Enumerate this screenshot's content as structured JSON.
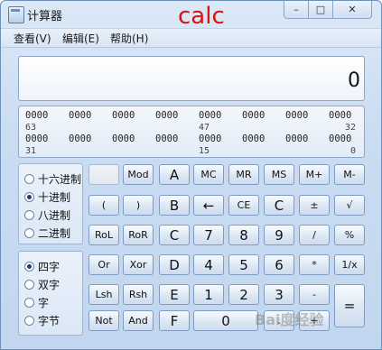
{
  "window": {
    "title": "计算器",
    "overlay_text": "calc"
  },
  "controls": {
    "minimize": "–",
    "maximize": "□",
    "close": "✕"
  },
  "menu": [
    "查看(V)",
    "编辑(E)",
    "帮助(H)"
  ],
  "display": {
    "value": "0"
  },
  "binary": {
    "row1": [
      "0000",
      "0000",
      "0000",
      "0000",
      "0000",
      "0000",
      "0000",
      "0000"
    ],
    "row1_marks": [
      "63",
      "47",
      "32"
    ],
    "row2": [
      "0000",
      "0000",
      "0000",
      "0000",
      "0000",
      "0000",
      "0000",
      "0000"
    ],
    "row2_marks": [
      "31",
      "15",
      "0"
    ]
  },
  "base_radios": [
    {
      "label": "十六进制",
      "selected": false
    },
    {
      "label": "十进制",
      "selected": true
    },
    {
      "label": "八进制",
      "selected": false
    },
    {
      "label": "二进制",
      "selected": false
    }
  ],
  "word_radios": [
    {
      "label": "四字",
      "selected": true
    },
    {
      "label": "双字",
      "selected": false
    },
    {
      "label": "字",
      "selected": false
    },
    {
      "label": "字节",
      "selected": false
    }
  ],
  "keys": {
    "r1": [
      "",
      "Mod",
      "A",
      "MC",
      "MR",
      "MS",
      "M+",
      "M-"
    ],
    "r2": [
      "(",
      ")",
      "B",
      "←",
      "CE",
      "C",
      "±",
      "√"
    ],
    "r3": [
      "RoL",
      "RoR",
      "C",
      "7",
      "8",
      "9",
      "/",
      "%"
    ],
    "r4": [
      "Or",
      "Xor",
      "D",
      "4",
      "5",
      "6",
      "*",
      "1/x"
    ],
    "r5": [
      "Lsh",
      "Rsh",
      "E",
      "1",
      "2",
      "3",
      "-",
      "="
    ],
    "r6": [
      "Not",
      "And",
      "F",
      "0",
      ".",
      "+"
    ]
  },
  "watermark": "Bai度经验"
}
